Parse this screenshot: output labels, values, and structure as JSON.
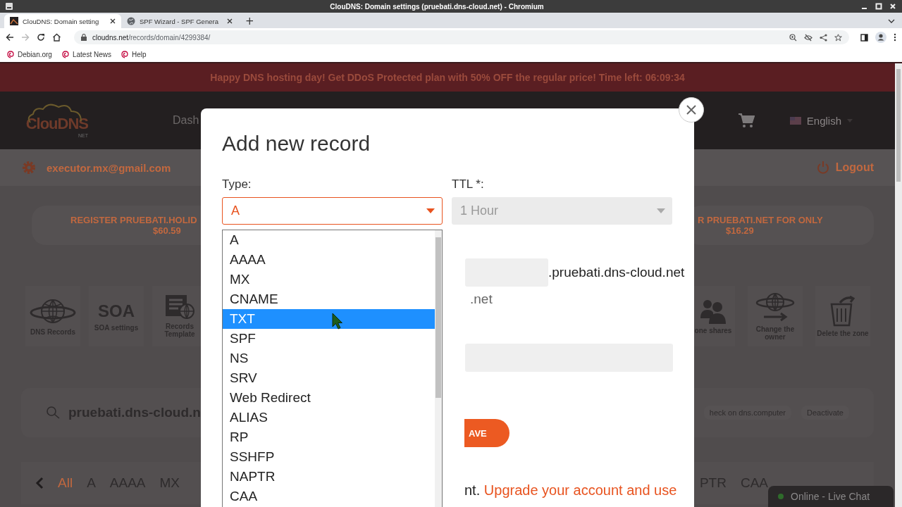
{
  "window": {
    "title": "ClouDNS: Domain settings (pruebati.dns-cloud.net) - Chromium"
  },
  "tabs": [
    {
      "title": "ClouDNS: Domain setting",
      "selected": true
    },
    {
      "title": "SPF Wizard - SPF Genera",
      "selected": false
    }
  ],
  "new_tab": "+",
  "address": {
    "host": "cloudns.net",
    "path": "/records/domain/4299384/"
  },
  "bookmarks": [
    "Debian.org",
    "Latest News",
    "Help"
  ],
  "page": {
    "banner": "Happy DNS hosting day! Get DDoS Protected plan with 50% OFF the regular price! Time left: 06:09:34",
    "logo": {
      "name": "ClouDNS",
      "sub": "NET"
    },
    "nav": "Dash",
    "language": "English",
    "user_email": "executor.mx@gmail.com",
    "logout": "Logout",
    "promos": [
      {
        "text": "REGISTER PRUEBATI.HOLID",
        "price": "$60.59"
      },
      {
        "text": "R PRUEBATI.NET FOR ONLY",
        "price": "$16.29"
      }
    ],
    "tiles_left": [
      {
        "kind": "globe",
        "label": "DNS Records"
      },
      {
        "kind": "soa",
        "icon_text": "SOA",
        "label": "SOA settings"
      },
      {
        "kind": "templates",
        "label": "Records Template"
      }
    ],
    "tiles_right": [
      {
        "kind": "people",
        "label": "one shares"
      },
      {
        "kind": "owner",
        "label": "Change the owner"
      },
      {
        "kind": "trash",
        "label": "Delete the zone"
      }
    ],
    "zone": "pruebati.dns-cloud.n",
    "zone_actions": [
      "heck on dns.computer",
      "Deactivate"
    ],
    "filters_left": [
      {
        "label": "All",
        "selected": true
      },
      {
        "label": "A",
        "selected": false
      },
      {
        "label": "AAAA",
        "selected": false
      },
      {
        "label": "MX",
        "selected": false
      }
    ],
    "filters_right": [
      {
        "label": "PTR",
        "selected": false
      },
      {
        "label": "CAA",
        "selected": false
      }
    ],
    "live_chat": "Online - Live Chat"
  },
  "dialog": {
    "title": "Add new record",
    "type_label": "Type:",
    "type_value": "A",
    "ttl_label": "TTL *:",
    "ttl_value": "1 Hour",
    "host_suffix": ".pruebati.dns-cloud.net",
    "host_hint": ".net",
    "save": "AVE",
    "note_start": "nt.",
    "note_link": "Upgrade your account and use",
    "options": [
      {
        "label": "A",
        "selected": false
      },
      {
        "label": "AAAA",
        "selected": false
      },
      {
        "label": "MX",
        "selected": false
      },
      {
        "label": "CNAME",
        "selected": false
      },
      {
        "label": "TXT",
        "selected": true
      },
      {
        "label": "SPF",
        "selected": false
      },
      {
        "label": "NS",
        "selected": false
      },
      {
        "label": "SRV",
        "selected": false
      },
      {
        "label": "Web Redirect",
        "selected": false
      },
      {
        "label": "ALIAS",
        "selected": false
      },
      {
        "label": "RP",
        "selected": false
      },
      {
        "label": "SSHFP",
        "selected": false
      },
      {
        "label": "NAPTR",
        "selected": false
      },
      {
        "label": "CAA",
        "selected": false
      }
    ]
  }
}
